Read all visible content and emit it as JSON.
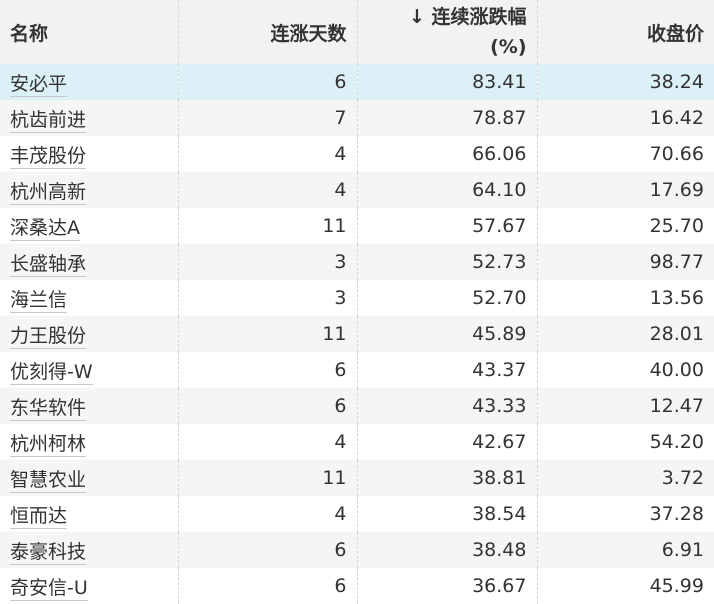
{
  "headers": {
    "name": "名称",
    "days": "连涨天数",
    "sort_arrow": "↓",
    "pct_line1": "连续涨跌幅",
    "pct_line2": "(%)",
    "close": "收盘价"
  },
  "rows": [
    {
      "name": "安必平",
      "days": "6",
      "pct": "83.41",
      "close": "38.24"
    },
    {
      "name": "杭齿前进",
      "days": "7",
      "pct": "78.87",
      "close": "16.42"
    },
    {
      "name": "丰茂股份",
      "days": "4",
      "pct": "66.06",
      "close": "70.66"
    },
    {
      "name": "杭州高新",
      "days": "4",
      "pct": "64.10",
      "close": "17.69"
    },
    {
      "name": "深桑达A",
      "days": "11",
      "pct": "57.67",
      "close": "25.70"
    },
    {
      "name": "长盛轴承",
      "days": "3",
      "pct": "52.73",
      "close": "98.77"
    },
    {
      "name": "海兰信",
      "days": "3",
      "pct": "52.70",
      "close": "13.56"
    },
    {
      "name": "力王股份",
      "days": "11",
      "pct": "45.89",
      "close": "28.01"
    },
    {
      "name": "优刻得-W",
      "days": "6",
      "pct": "43.37",
      "close": "40.00"
    },
    {
      "name": "东华软件",
      "days": "6",
      "pct": "43.33",
      "close": "12.47"
    },
    {
      "name": "杭州柯林",
      "days": "4",
      "pct": "42.67",
      "close": "54.20"
    },
    {
      "name": "智慧农业",
      "days": "11",
      "pct": "38.81",
      "close": "3.72"
    },
    {
      "name": "恒而达",
      "days": "4",
      "pct": "38.54",
      "close": "37.28"
    },
    {
      "name": "泰豪科技",
      "days": "6",
      "pct": "38.48",
      "close": "6.91"
    },
    {
      "name": "奇安信-U",
      "days": "6",
      "pct": "36.67",
      "close": "45.99"
    }
  ]
}
